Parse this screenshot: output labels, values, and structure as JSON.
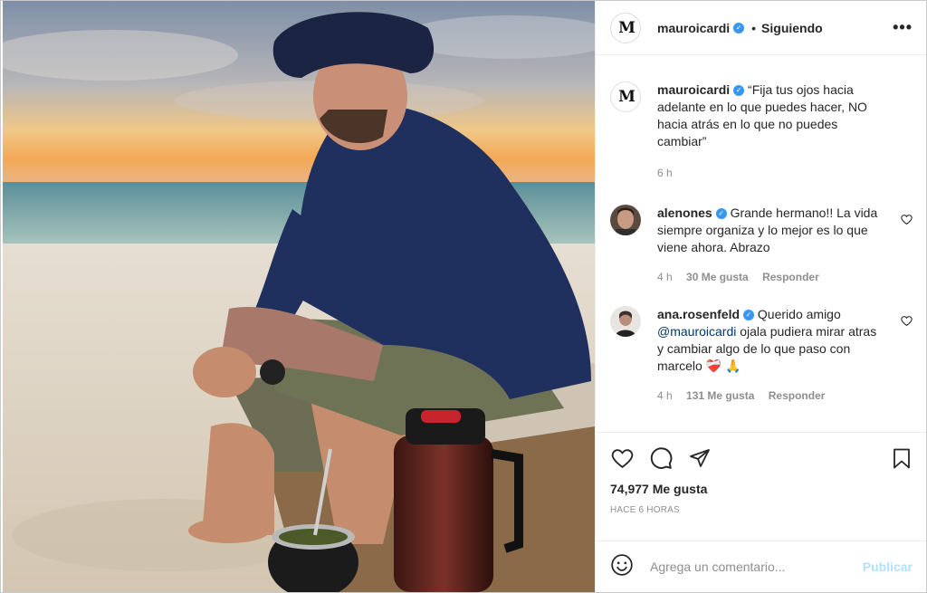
{
  "header": {
    "logo_text": "M",
    "username": "mauroicardi",
    "verified_icon": "verified-badge-icon",
    "separator": "•",
    "follow_status": "Siguiendo",
    "more_icon": "more-options-icon",
    "more_text": "•••"
  },
  "caption": {
    "username": "mauroicardi",
    "text": "“Fija tus ojos hacia adelante en lo que puedes hacer, NO hacia atrás en lo que no puedes cambiar”",
    "time": "6 h"
  },
  "comments": [
    {
      "username": "alenones",
      "text": "Grande hermano!! La vida siempre organiza y lo mejor es lo que viene ahora. Abrazo",
      "time": "4 h",
      "likes": "30 Me gusta",
      "reply": "Responder"
    },
    {
      "username": "ana.rosenfeld",
      "text_before": "Querido amigo",
      "mention": "@mauroicardi",
      "text_after": "ojala pudiera mirar atras y cambiar algo de lo que paso con marcelo",
      "emojis": "❤️‍🩹 🙏",
      "time": "4 h",
      "likes": "131 Me gusta",
      "reply": "Responder"
    }
  ],
  "actions": {
    "like_icon": "heart-icon",
    "comment_icon": "comment-icon",
    "share_icon": "share-icon",
    "save_icon": "bookmark-icon",
    "likes": "74,977 Me gusta",
    "posted": "HACE 6 HORAS"
  },
  "add_comment": {
    "emoji_icon": "emoji-icon",
    "placeholder": "Agrega un comentario...",
    "publish": "Publicar"
  },
  "colors": {
    "accent": "#3897f0",
    "publish_disabled": "#b2dffc",
    "muted": "#8e8e8e"
  }
}
